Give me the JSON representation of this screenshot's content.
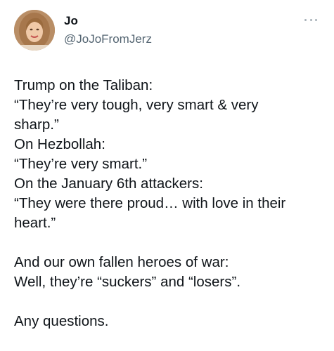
{
  "tweet": {
    "author_name": "Jo",
    "author_handle": "@JoJoFromJerz",
    "more_icon": "more-horizontal-icon",
    "lines": [
      "Trump on the Taliban:",
      "“They’re very tough, very smart & very",
      "sharp.”",
      "On Hezbollah:",
      "“They’re very smart.”",
      "On the January 6th attackers:",
      "“They were there proud… with love in their",
      "heart.”",
      "",
      "And our own fallen heroes of war:",
      "Well, they’re “suckers” and “losers”.",
      "",
      "Any questions."
    ]
  }
}
